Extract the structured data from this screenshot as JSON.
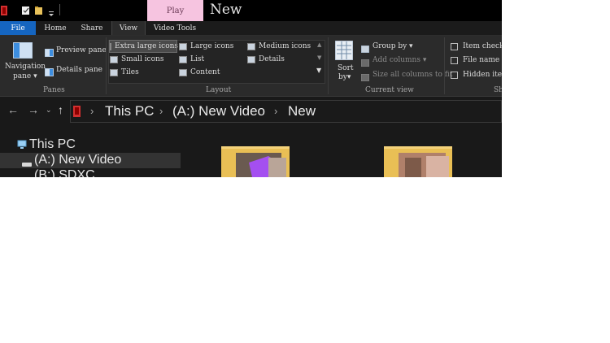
{
  "window": {
    "title": "New",
    "context_tab": "Play"
  },
  "tabs": [
    {
      "label": "File"
    },
    {
      "label": "Home"
    },
    {
      "label": "Share"
    },
    {
      "label": "View"
    },
    {
      "label": "Video Tools"
    }
  ],
  "ribbon": {
    "panes": {
      "navigation_pane": "Navigation",
      "navigation_pane_2": "pane",
      "preview_pane": "Preview pane",
      "details_pane": "Details pane",
      "group_label": "Panes"
    },
    "layout": {
      "items": [
        "Extra large icons",
        "Large icons",
        "Medium icons",
        "Small icons",
        "List",
        "Details",
        "Tiles",
        "Content"
      ],
      "selected": "Extra large icons",
      "group_label": "Layout"
    },
    "current_view": {
      "sort_by": "Sort",
      "sort_by_2": "by",
      "group_by": "Group by",
      "add_columns": "Add columns",
      "size_columns": "Size all columns to fit",
      "group_label": "Current view"
    },
    "show_hide": {
      "item_check_boxes": "Item check b",
      "file_name_extensions": "File name ex",
      "hidden_items": "Hidden item",
      "group_label": "Sh"
    }
  },
  "address": {
    "crumbs": [
      "This PC",
      "(A:) New Video",
      "New"
    ]
  },
  "nav_tree": [
    {
      "label": "This PC"
    },
    {
      "label": "(A:) New Video"
    },
    {
      "label": "(B:) SDXC"
    }
  ],
  "colors": {
    "accent": "#1565c0",
    "context_tab": "#f6c4e0",
    "background": "#191919"
  }
}
